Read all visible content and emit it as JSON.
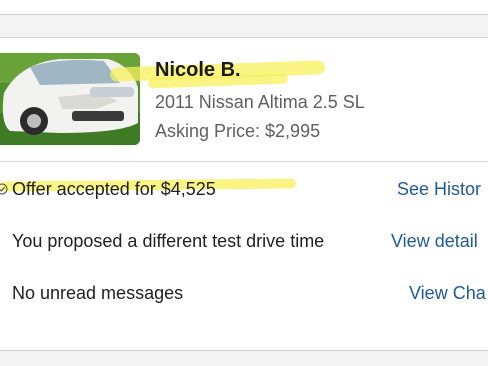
{
  "card": {
    "seller_name": "Nicole B.",
    "car_title": "2011 Nissan Altima 2.5 SL",
    "asking_price": "Asking Price: $2,995"
  },
  "rows": [
    {
      "text": "Offer accepted for $4,525",
      "link": "See Histor",
      "icon": "check-circle-icon"
    },
    {
      "text": "You proposed a different test drive time",
      "link": "View detail"
    },
    {
      "text": "No unread messages",
      "link": "View Cha"
    }
  ],
  "colors": {
    "link": "#1f5a96",
    "highlight": "#f7f05a",
    "text_secondary": "#5f5f5f"
  }
}
